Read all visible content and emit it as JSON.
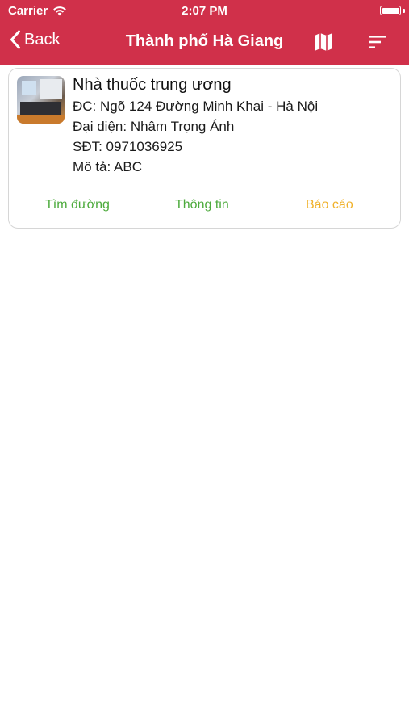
{
  "status_bar": {
    "carrier": "Carrier",
    "time": "2:07 PM",
    "wifi_icon": "wifi-icon",
    "battery_icon": "battery-icon"
  },
  "nav": {
    "back_label": "Back",
    "title": "Thành phố Hà Giang",
    "map_icon": "map-icon",
    "sort_icon": "sort-icon",
    "bar_color": "#d0304a"
  },
  "pharmacy": {
    "name": "Nhà thuốc trung ương",
    "address": "ĐC: Ngõ 124 Đường Minh Khai - Hà Nội",
    "representative": "Đại diện: Nhâm Trọng Ánh",
    "phone": "SĐT: 0971036925",
    "description": "Mô tả: ABC",
    "actions": {
      "directions": "Tìm đường",
      "info": "Thông tin",
      "report": "Báo cáo"
    }
  },
  "colors": {
    "green_action": "#4caa3c",
    "yellow_action": "#f0b12a"
  }
}
